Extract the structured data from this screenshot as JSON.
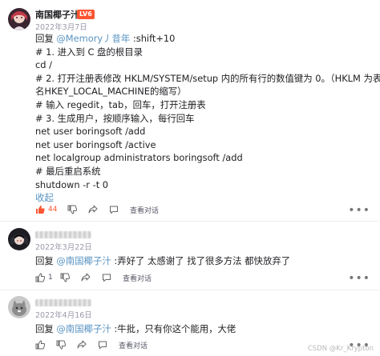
{
  "comments": [
    {
      "author": "南国椰子汁",
      "badge": "LV6",
      "date": "2022年3月7日",
      "lines": {
        "l1_prefix": "回复 ",
        "l1_mention": "@Memory丿昔年",
        "l1_suffix": " :shift+10",
        "l2": "# 1. 进入到 C 盘的根目录",
        "l3": "cd /",
        "l4": "# 2. 打开注册表修改 HKLM/SYSTEM/setup 内的所有行的数值键为 0。（HKLM 为表",
        "l5": "名HKEY_LOCAL_MACHINE的缩写）",
        "l6": "# 输入 regedit，tab，回车，打开注册表",
        "l7": "# 3. 生成用户，按顺序输入，每行回车",
        "l8": "net user boringsoft /add",
        "l9": "net user boringsoft /active",
        "l10": "net localgroup administrators boringsoft /add",
        "l11": "# 最后重启系统",
        "l12": "shutdown -r -t 0",
        "collapse": "收起"
      },
      "likes": "44",
      "view_thread": "查看对话",
      "more": "•••"
    },
    {
      "author": "",
      "date": "2022年3月22日",
      "reply_prefix": "回复 ",
      "mention": "@南国椰子汁",
      "text": " :弄好了 太感谢了 找了很多方法 都快放弃了",
      "likes": "1",
      "view_thread": "查看对话",
      "more": "•••"
    },
    {
      "author": "",
      "date": "2022年4月16日",
      "reply_prefix": "回复 ",
      "mention": "@南国椰子汁",
      "text": " :牛批，只有你这个能用，大佬",
      "view_thread": "查看对话",
      "more": "•••"
    }
  ],
  "watermark": "CSDN @Kr_Krypton",
  "colors": {
    "accent_link": "#5893c2",
    "liked": "#fc5531",
    "badge": "#fc5531",
    "muted": "#999aaa"
  }
}
